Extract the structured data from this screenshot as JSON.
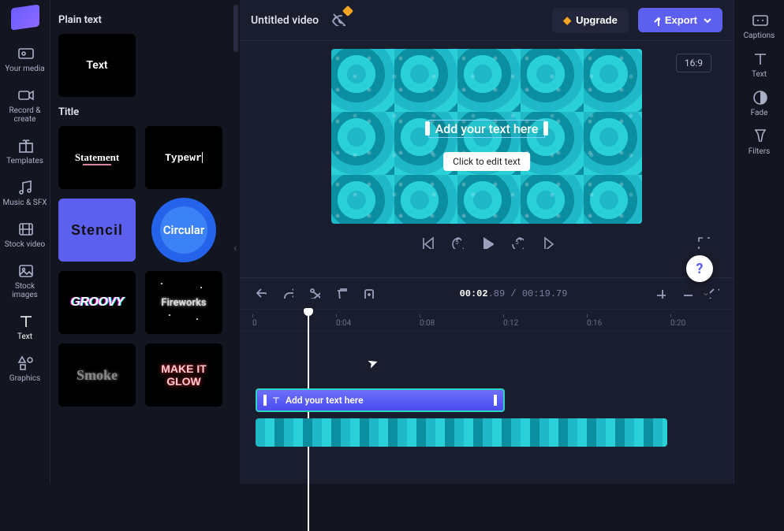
{
  "nav": {
    "items": [
      {
        "label": "Your media"
      },
      {
        "label": "Record & create"
      },
      {
        "label": "Templates"
      },
      {
        "label": "Music & SFX"
      },
      {
        "label": "Stock video"
      },
      {
        "label": "Stock images"
      },
      {
        "label": "Text"
      },
      {
        "label": "Graphics"
      }
    ],
    "active_index": 6
  },
  "panel": {
    "section_plain": "Plain text",
    "section_title": "Title",
    "thumb_text": "Text",
    "titles": [
      {
        "label": "Statement"
      },
      {
        "label": "Typewr"
      },
      {
        "label": "Stencil"
      },
      {
        "label": "Circular"
      },
      {
        "label": "GROOVY"
      },
      {
        "label": "Fireworks"
      },
      {
        "label": "Smoke"
      },
      {
        "label": "MAKE IT GLOW"
      }
    ]
  },
  "topbar": {
    "title": "Untitled video",
    "upgrade": "Upgrade",
    "export": "Export"
  },
  "preview": {
    "aspect": "16:9",
    "overlay_text": "Add your text here",
    "tooltip": "Click to edit text",
    "rewind_seconds": "5",
    "forward_seconds": "5"
  },
  "timeline": {
    "current": "00:02",
    "current_frac": ".89",
    "total": "00:19",
    "total_frac": ".79",
    "ticks": [
      "0",
      "0:04",
      "0:08",
      "0:12",
      "0:16",
      "0:20"
    ],
    "text_clip_label": "Add your text here"
  },
  "rsidebar": {
    "items": [
      {
        "label": "Captions"
      },
      {
        "label": "Text"
      },
      {
        "label": "Fade"
      },
      {
        "label": "Filters"
      }
    ]
  }
}
